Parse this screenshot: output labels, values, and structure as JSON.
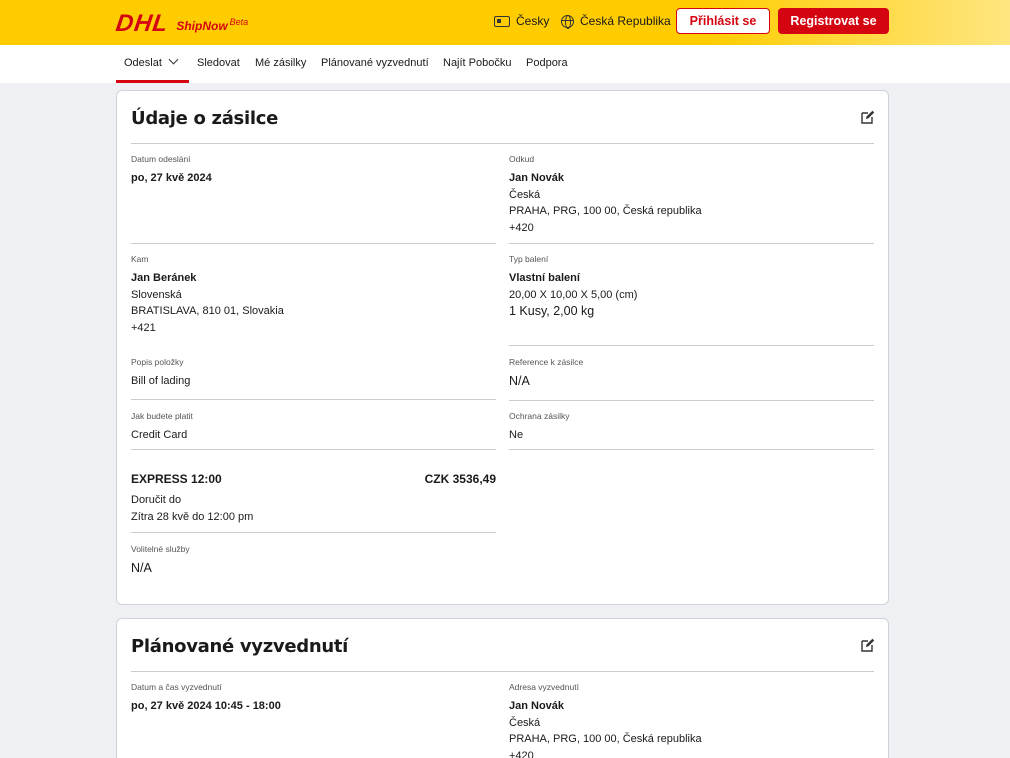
{
  "header": {
    "logo_text": "DHL",
    "product_name": "ShipNow",
    "product_badge": "Beta",
    "language": "Česky",
    "country": "Česká Republika",
    "login_label": "Přihlásit se",
    "register_label": "Registrovat se"
  },
  "nav": {
    "items": [
      "Odeslat",
      "Sledovat",
      "Mé zásilky",
      "Plánované vyzvednutí",
      "Najít Pobočku",
      "Podpora"
    ],
    "active": "Odeslat"
  },
  "shipment": {
    "title": "Údaje o zásilce",
    "ship_date": {
      "label": "Datum odeslání",
      "value": "po, 27 kvě 2024"
    },
    "from": {
      "label": "Odkud",
      "name": "Jan Novák",
      "line1": "Česká",
      "line2": "PRAHA, PRG, 100 00, Česká republika",
      "line3": "+420"
    },
    "to": {
      "label": "Kam",
      "name": "Jan Beránek",
      "line1": "Slovenská",
      "line2": "BRATISLAVA, 810 01, Slovakia",
      "line3": "+421"
    },
    "packaging": {
      "label": "Typ balení",
      "name": "Vlastní balení",
      "dims": "20,00 X 10,00 X 5,00 (cm)",
      "qty": "1 Kusy, 2,00 kg"
    },
    "item_desc": {
      "label": "Popis položky",
      "value": "Bill of lading"
    },
    "reference": {
      "label": "Reference k zásilce",
      "value": "N/A"
    },
    "payment": {
      "label": "Jak budete platit",
      "value": "Credit Card"
    },
    "protection": {
      "label": "Ochrana zásilky",
      "value": "Ne"
    },
    "service": {
      "name": "EXPRESS 12:00",
      "price": "CZK 3536,49",
      "deliver_label": "Doručit do",
      "deliver_value": "Zítra 28 kvě do 12:00 pm"
    },
    "optional": {
      "label": "Volitelné služby",
      "value": "N/A"
    }
  },
  "pickup": {
    "title": "Plánované vyzvednutí",
    "datetime": {
      "label": "Datum a čas vyzvednutí",
      "value": "po, 27 kvě 2024 10:45 - 18:00"
    },
    "address": {
      "label": "Adresa vyzvednutí",
      "name": "Jan Novák",
      "line1": "Česká",
      "line2": "PRAHA, PRG, 100 00, Česká republika",
      "line3": "+420"
    }
  },
  "colors": {
    "brand_yellow": "#ffcc00",
    "brand_red": "#d40511"
  }
}
